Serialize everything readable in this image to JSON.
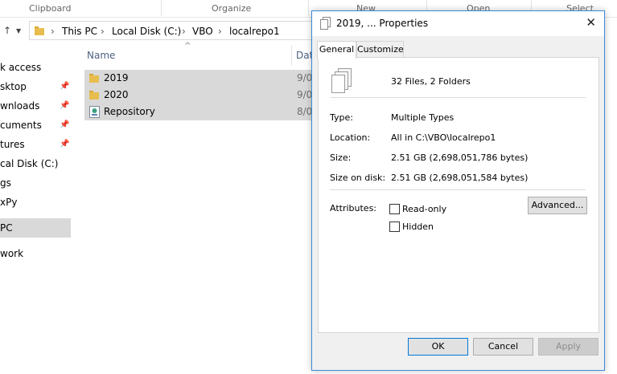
{
  "ribbon": {
    "groups": [
      "Clipboard",
      "Organize",
      "New",
      "Open",
      "Select"
    ]
  },
  "address": {
    "crumbs": [
      "This PC",
      "Local Disk (C:)",
      "VBO",
      "localrepo1"
    ]
  },
  "nav": {
    "items": [
      {
        "label": "k access",
        "pinned": false
      },
      {
        "label": "sktop",
        "pinned": true
      },
      {
        "label": "wnloads",
        "pinned": true
      },
      {
        "label": "cuments",
        "pinned": true
      },
      {
        "label": "tures",
        "pinned": true
      },
      {
        "label": "cal Disk (C:)",
        "pinned": false
      },
      {
        "label": "gs",
        "pinned": false
      },
      {
        "label": "xPy",
        "pinned": false
      },
      {
        "label": "PC",
        "pinned": false,
        "selected": true
      },
      {
        "label": "work",
        "pinned": false
      }
    ]
  },
  "filelist": {
    "col_name": "Name",
    "col_date": "Dat",
    "rows": [
      {
        "name": "2019",
        "date": "9/0",
        "type": "folder"
      },
      {
        "name": "2020",
        "date": "9/0",
        "type": "folder"
      },
      {
        "name": "Repository",
        "date": "8/0",
        "type": "file"
      }
    ]
  },
  "dialog": {
    "title": "2019, ... Properties",
    "tabs": [
      "General",
      "Customize"
    ],
    "summary": "32 Files, 2 Folders",
    "type_label": "Type:",
    "type_value": "Multiple Types",
    "location_label": "Location:",
    "location_value": "All in C:\\VBO\\localrepo1",
    "size_label": "Size:",
    "size_value": "2.51 GB (2,698,051,786 bytes)",
    "size_disk_label": "Size on disk:",
    "size_disk_value": "2.51 GB (2,698,051,584 bytes)",
    "attributes_label": "Attributes:",
    "readonly_label": "Read-only",
    "hidden_label": "Hidden",
    "advanced_label": "Advanced...",
    "ok_label": "OK",
    "cancel_label": "Cancel",
    "apply_label": "Apply"
  },
  "colors": {
    "dialog_border": "#3c8ad8",
    "selection": "#d9d9d9",
    "folder": "#e7bd4d"
  }
}
